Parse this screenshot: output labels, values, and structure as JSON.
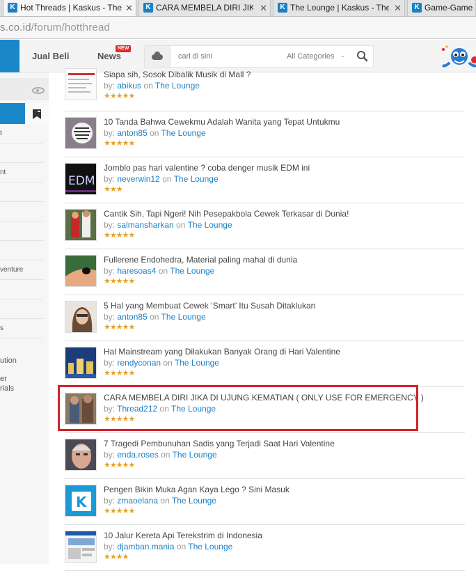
{
  "browser": {
    "tabs": [
      {
        "title": "Hot Threads | Kaskus - The",
        "active": true
      },
      {
        "title": "CARA MEMBELA DIRI JIKA",
        "active": false
      },
      {
        "title": "The Lounge | Kaskus - The",
        "active": false
      },
      {
        "title": "Game-Game F",
        "active": false
      }
    ],
    "url_domain": "s.co.id",
    "url_path": "/forum/hotthread"
  },
  "header": {
    "nav": {
      "jual_beli": "Jual Beli",
      "news": "News",
      "new_badge": "NEW"
    },
    "search": {
      "placeholder": "cari di sini",
      "category": "All Categories"
    }
  },
  "sidebar": {
    "items": [
      "t",
      "nt",
      "venture",
      "s"
    ],
    "bottom_items": [
      "ution",
      "er",
      "rials"
    ]
  },
  "threads": [
    {
      "title": "Siapa sih, Sosok Dibalik Musik di Mall ?",
      "by_label": "by:",
      "author": "abikus",
      "on_label": "on",
      "forum": "The Lounge",
      "rating": 5,
      "thumb": "doc-thumb"
    },
    {
      "title": "10 Tanda Bahwa Cewekmu Adalah Wanita yang Tepat Untukmu",
      "by_label": "by:",
      "author": "anton85",
      "on_label": "on",
      "forum": "The Lounge",
      "rating": 5,
      "thumb": "quote-thumb"
    },
    {
      "title": "Jomblo pas hari valentine ? coba denger musik EDM ini",
      "by_label": "by:",
      "author": "neverwin12",
      "on_label": "on",
      "forum": "The Lounge",
      "rating": 3,
      "thumb": "edm-thumb"
    },
    {
      "title": "Cantik Sih, Tapi Ngeri! Nih Pesepakbola Cewek Terkasar di Dunia!",
      "by_label": "by:",
      "author": "salmansharkan",
      "on_label": "on",
      "forum": "The Lounge",
      "rating": 5,
      "thumb": "football-thumb"
    },
    {
      "title": "Fullerene Endohedra, Material paling mahal di dunia",
      "by_label": "by:",
      "author": "haresoas4",
      "on_label": "on",
      "forum": "The Lounge",
      "rating": 5,
      "thumb": "finger-thumb"
    },
    {
      "title": "5 Hal yang Membuat Cewek ‘Smart’ Itu Susah Ditaklukan",
      "by_label": "by:",
      "author": "anton85",
      "on_label": "on",
      "forum": "The Lounge",
      "rating": 5,
      "thumb": "woman-thumb"
    },
    {
      "title": "Hal Mainstream yang Dilakukan Banyak Orang di Hari Valentine",
      "by_label": "by:",
      "author": "rendyconan",
      "on_label": "on",
      "forum": "The Lounge",
      "rating": 5,
      "thumb": "city-thumb"
    },
    {
      "title": "CARA MEMBELA DIRI JIKA DI UJUNG KEMATIAN ( ONLY USE FOR EMERGENCY )",
      "by_label": "by:",
      "author": "Thread212",
      "on_label": "on",
      "forum": "The Lounge",
      "rating": 5,
      "thumb": "fight-thumb"
    },
    {
      "title": "7 Tragedi Pembunuhan Sadis yang Terjadi Saat Hari Valentine",
      "by_label": "by:",
      "author": "enda.roses",
      "on_label": "on",
      "forum": "The Lounge",
      "rating": 5,
      "thumb": "face-thumb"
    },
    {
      "title": "Pengen Bikin Muka Agan Kaya Lego ? Sini Masuk",
      "by_label": "by:",
      "author": "zmaoelana",
      "on_label": "on",
      "forum": "The Lounge",
      "rating": 5,
      "thumb": "kaskus-logo-thumb"
    },
    {
      "title": "10 Jalur Kereta Api Terekstrim di Indonesia",
      "by_label": "by:",
      "author": "djamban.mania",
      "on_label": "on",
      "forum": "The Lounge",
      "rating": 4,
      "thumb": "web-thumb"
    }
  ],
  "colors": {
    "accent": "#1a87c9",
    "link": "#1a80c6",
    "star": "#e5a02c",
    "highlight": "#d0242b",
    "badge": "#e8252a"
  }
}
